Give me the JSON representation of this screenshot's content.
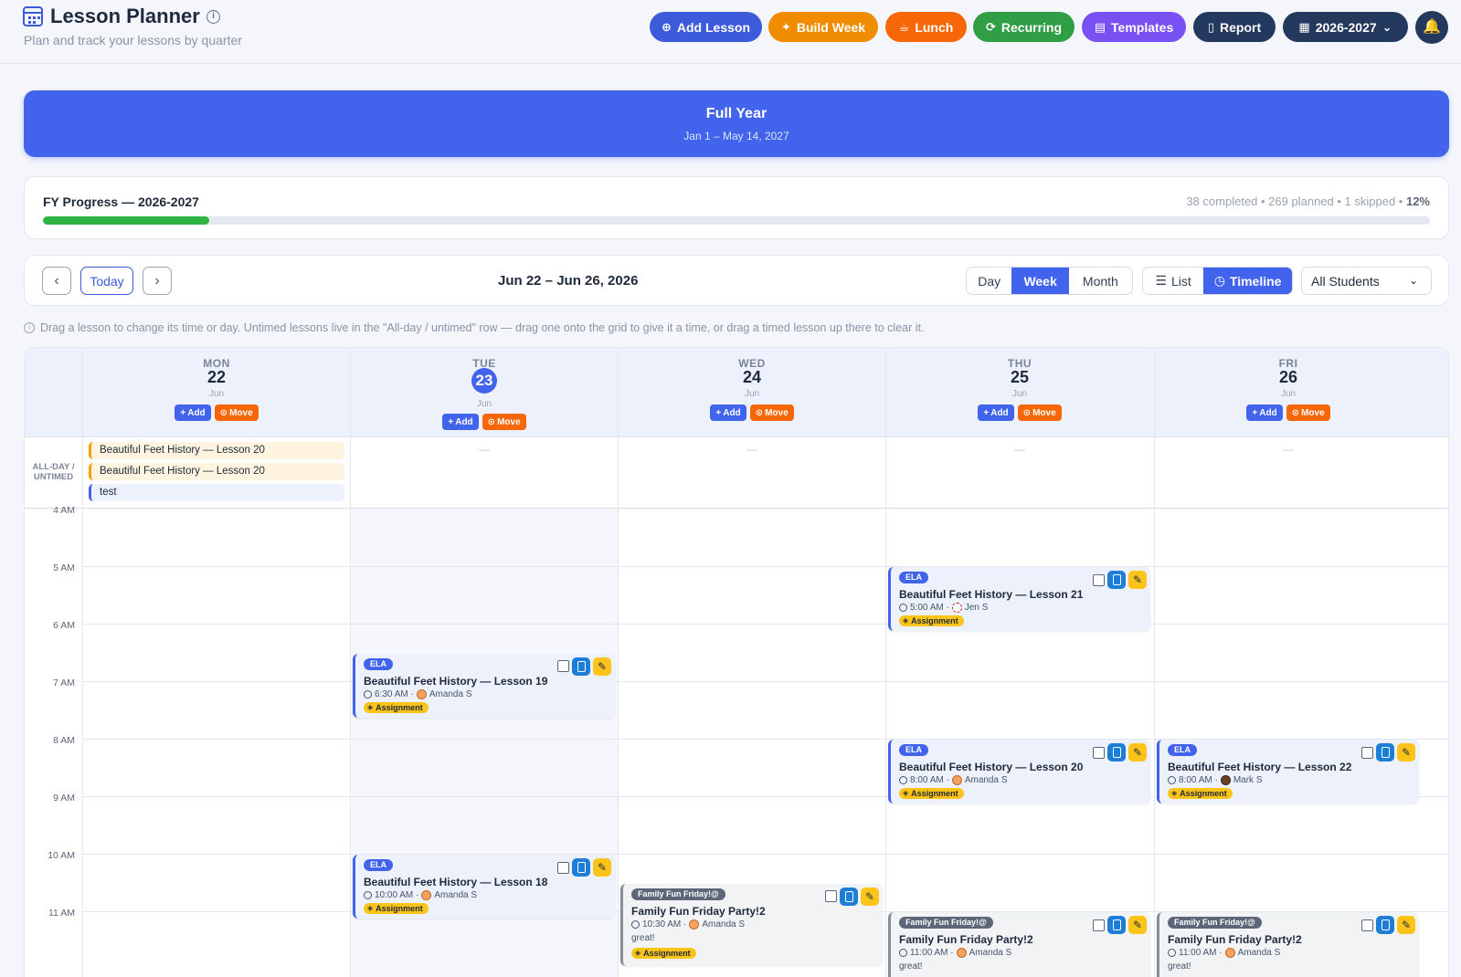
{
  "header": {
    "title": "Lesson Planner",
    "subtitle": "Plan and track your lessons by quarter",
    "buttons": {
      "add_lesson": "Add Lesson",
      "build_week": "Build Week",
      "lunch": "Lunch",
      "recurring": "Recurring",
      "templates": "Templates",
      "report": "Report",
      "year": "2026-2027"
    }
  },
  "banner": {
    "title": "Full Year",
    "dates": "Jan 1 – May 14, 2027"
  },
  "progress": {
    "title": "FY Progress — 2026-2027",
    "stats": "38 completed • 269 planned • 1 skipped •",
    "percent": "12%",
    "fraction": 0.12
  },
  "toolbar": {
    "today": "Today",
    "range": "Jun 22 – Jun 26, 2026",
    "views": [
      "Day",
      "Week",
      "Month"
    ],
    "active_view": "Week",
    "modes": [
      "List",
      "Timeline"
    ],
    "active_mode": "Timeline",
    "student_filter": "All Students"
  },
  "hint": "Drag a lesson to change its time or day. Untimed lessons live in the \"All-day / untimed\" row — drag one onto the grid to give it a time, or drag a timed lesson up there to clear it.",
  "calendar": {
    "allday_label": "ALL-DAY / UNTIMED",
    "empty_marker": "—",
    "day_add": "Add",
    "day_move": "Move",
    "days": [
      {
        "dow": "MON",
        "num": "22",
        "month": "Jun",
        "today": false
      },
      {
        "dow": "TUE",
        "num": "23",
        "month": "Jun",
        "today": true
      },
      {
        "dow": "WED",
        "num": "24",
        "month": "Jun",
        "today": false
      },
      {
        "dow": "THU",
        "num": "25",
        "month": "Jun",
        "today": false
      },
      {
        "dow": "FRI",
        "num": "26",
        "month": "Jun",
        "today": false
      }
    ],
    "allday_items": [
      {
        "day": 0,
        "title": "Beautiful Feet History — Lesson 20",
        "color": "orange"
      },
      {
        "day": 0,
        "title": "Beautiful Feet History — Lesson 20",
        "color": "orange"
      },
      {
        "day": 0,
        "title": "test",
        "color": "blue"
      }
    ],
    "hours": [
      "4 AM",
      "5 AM",
      "6 AM",
      "7 AM",
      "8 AM",
      "9 AM",
      "10 AM",
      "11 AM"
    ],
    "events": [
      {
        "day": 3,
        "tag": "ELA",
        "title": "Beautiful Feet History — Lesson 21",
        "time": "5:00 AM",
        "student": "Jen S",
        "badge": "Assignment",
        "note": ""
      },
      {
        "day": 1,
        "tag": "ELA",
        "title": "Beautiful Feet History — Lesson 19",
        "time": "6:30 AM",
        "student": "Amanda S",
        "badge": "Assignment",
        "note": ""
      },
      {
        "day": 3,
        "tag": "ELA",
        "title": "Beautiful Feet History — Lesson 20",
        "time": "8:00 AM",
        "student": "Amanda S",
        "badge": "Assignment",
        "note": ""
      },
      {
        "day": 4,
        "tag": "ELA",
        "title": "Beautiful Feet History — Lesson 22",
        "time": "8:00 AM",
        "student": "Mark S",
        "badge": "Assignment",
        "note": ""
      },
      {
        "day": 1,
        "tag": "ELA",
        "title": "Beautiful Feet History — Lesson 18",
        "time": "10:00 AM",
        "student": "Amanda S",
        "badge": "Assignment",
        "note": ""
      },
      {
        "day": 2,
        "tag": "Family Fun Friday!@",
        "title": "Family Fun Friday Party!2",
        "time": "10:30 AM",
        "student": "Amanda S",
        "badge": "Assignment",
        "note": "great!"
      },
      {
        "day": 3,
        "tag": "Family Fun Friday!@",
        "title": "Family Fun Friday Party!2",
        "time": "11:00 AM",
        "student": "Amanda S",
        "badge": "",
        "note": "great!"
      },
      {
        "day": 4,
        "tag": "Family Fun Friday!@",
        "title": "Family Fun Friday Party!2",
        "time": "11:00 AM",
        "student": "Amanda S",
        "badge": "",
        "note": "great!"
      }
    ]
  },
  "colors": {
    "primary": "#4263eb",
    "orange": "#f76707",
    "green": "#2fb344",
    "purple": "#7950f2",
    "navy": "#23395d",
    "badge": "#fcc419"
  }
}
